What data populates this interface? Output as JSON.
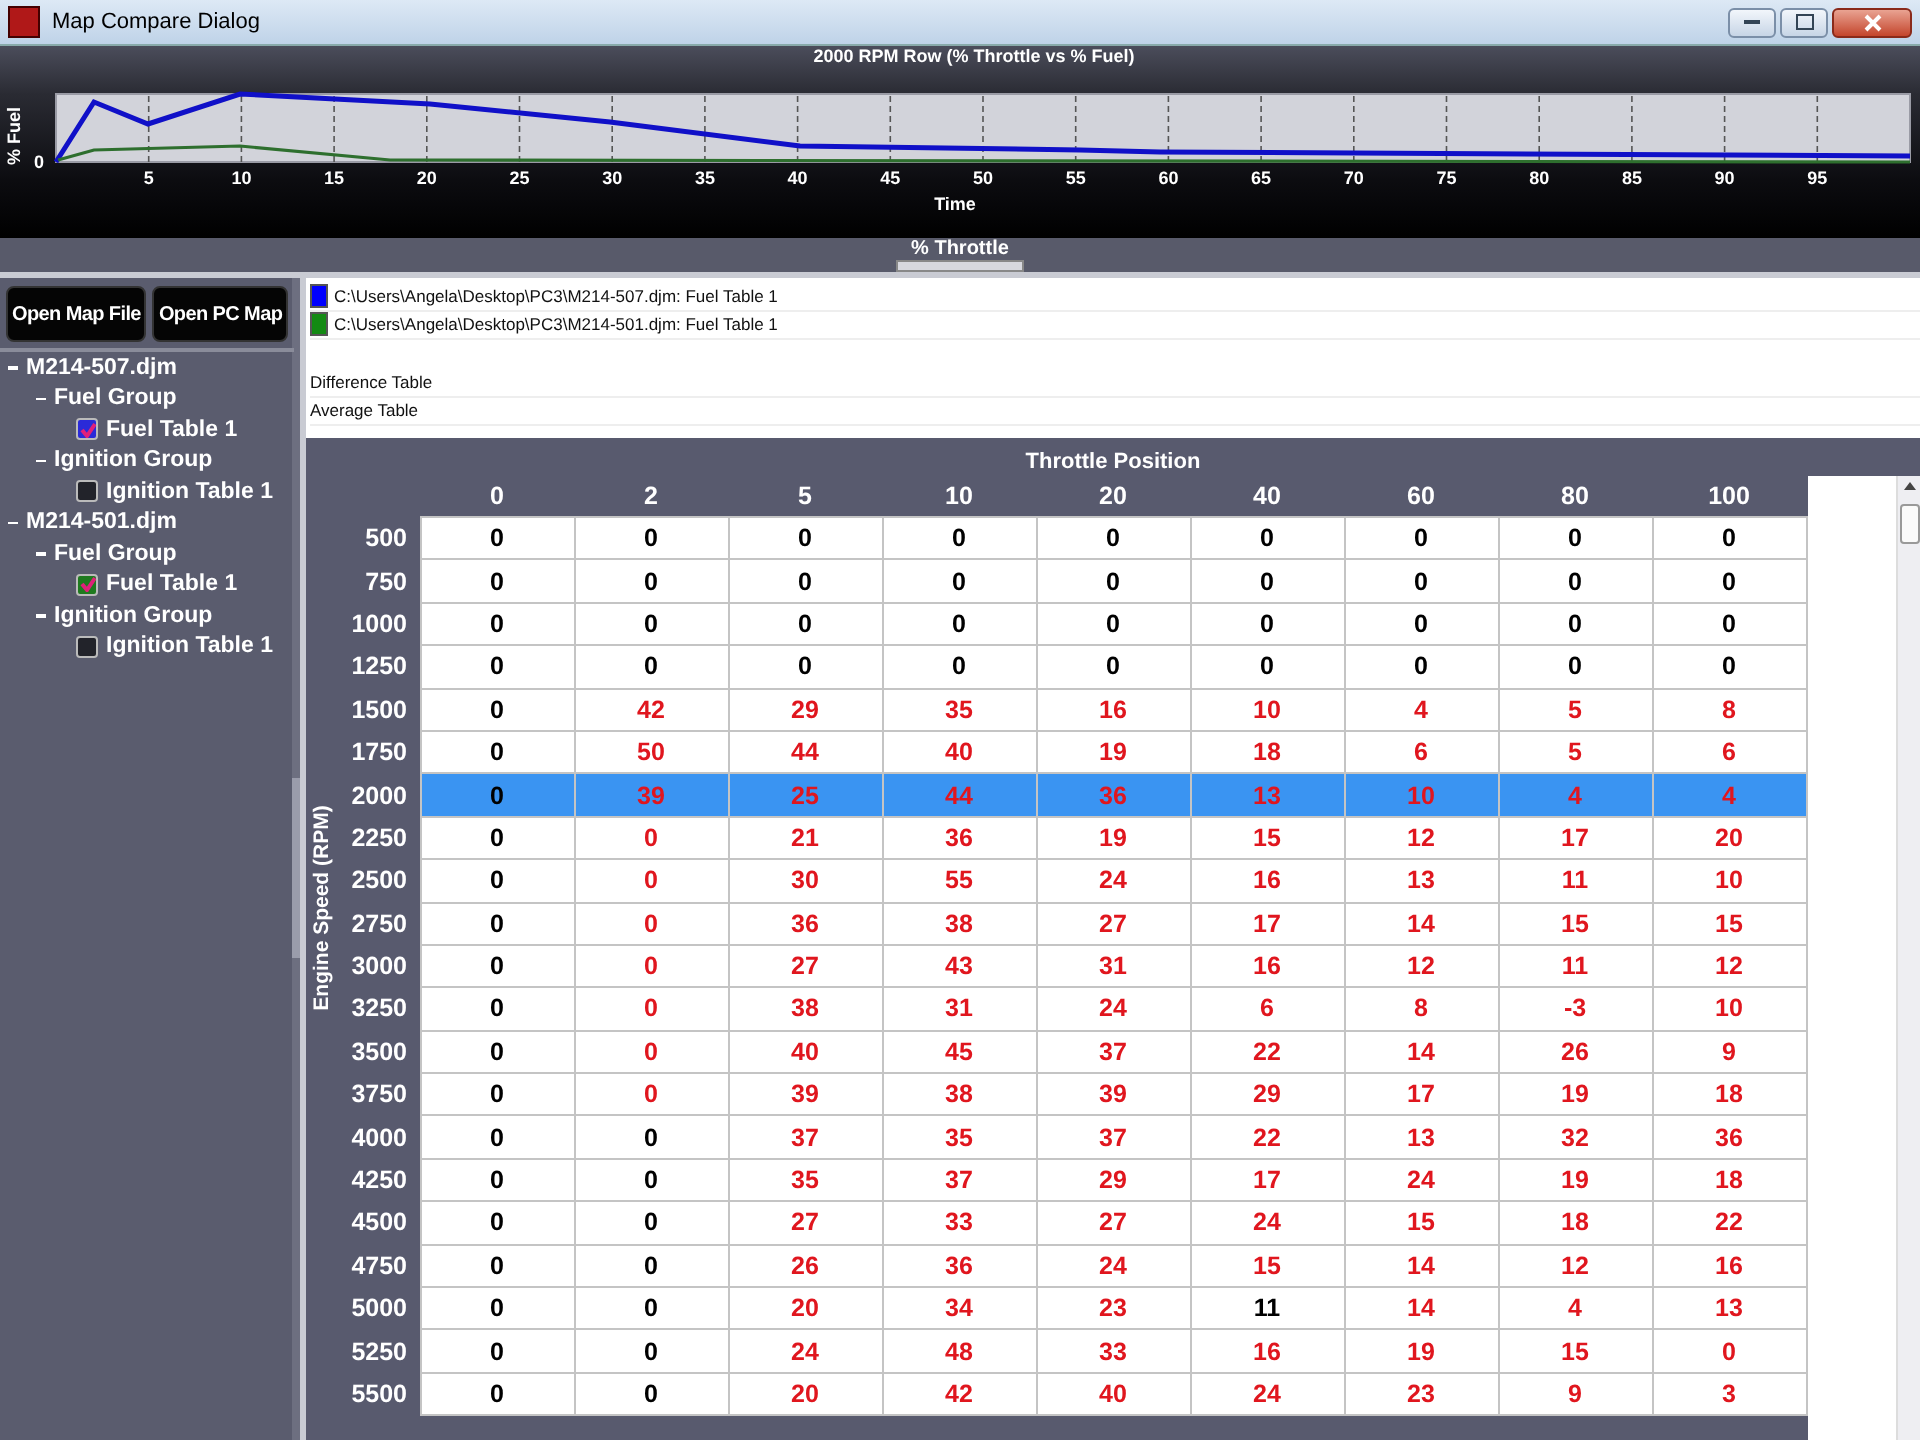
{
  "window": {
    "title": "Map Compare Dialog"
  },
  "chart": {
    "title": "2000 RPM Row (% Throttle vs % Fuel)",
    "ylabel": "% Fuel",
    "y_tick": "0",
    "xlabel": "Time",
    "x_ticks": [
      "5",
      "10",
      "15",
      "20",
      "25",
      "30",
      "35",
      "40",
      "45",
      "50",
      "55",
      "60",
      "65",
      "70",
      "75",
      "80",
      "85",
      "90",
      "95"
    ]
  },
  "splitter": {
    "label": "% Throttle"
  },
  "buttons": [
    "Open Map File",
    "Open PC Map"
  ],
  "tree": [
    {
      "label": "M214-507.djm",
      "expanded": true,
      "children": [
        {
          "label": "Fuel Group",
          "expanded": true,
          "children": [
            {
              "label": "Fuel Table 1",
              "checked": true,
              "color": "#2a2ad8"
            }
          ]
        },
        {
          "label": "Ignition Group",
          "expanded": true,
          "children": [
            {
              "label": "Ignition Table 1",
              "checked": false
            }
          ]
        }
      ]
    },
    {
      "label": "M214-501.djm",
      "expanded": true,
      "children": [
        {
          "label": "Fuel Group",
          "expanded": true,
          "children": [
            {
              "label": "Fuel Table 1",
              "checked": true,
              "color": "#1f7a1f"
            }
          ]
        },
        {
          "label": "Ignition Group",
          "expanded": true,
          "children": [
            {
              "label": "Ignition Table 1",
              "checked": false
            }
          ]
        }
      ]
    }
  ],
  "legend": [
    {
      "text": "C:\\Users\\Angela\\Desktop\\PC3\\M214-507.djm: Fuel Table 1",
      "color": "#0000ff"
    },
    {
      "text": "C:\\Users\\Angela\\Desktop\\PC3\\M214-501.djm: Fuel Table 1",
      "color": "#138a13"
    }
  ],
  "options": [
    "Difference Table",
    "Average Table"
  ],
  "table": {
    "title": "Throttle Position",
    "row_axis": "Engine Speed (RPM)",
    "columns": [
      "0",
      "2",
      "5",
      "10",
      "20",
      "40",
      "60",
      "80",
      "100"
    ],
    "rows": [
      {
        "label": "500",
        "selected": false,
        "values": [
          "0",
          "0",
          "0",
          "0",
          "0",
          "0",
          "0",
          "0",
          "0"
        ],
        "differs": [
          false,
          false,
          false,
          false,
          false,
          false,
          false,
          false,
          false
        ]
      },
      {
        "label": "750",
        "selected": false,
        "values": [
          "0",
          "0",
          "0",
          "0",
          "0",
          "0",
          "0",
          "0",
          "0"
        ],
        "differs": [
          false,
          false,
          false,
          false,
          false,
          false,
          false,
          false,
          false
        ]
      },
      {
        "label": "1000",
        "selected": false,
        "values": [
          "0",
          "0",
          "0",
          "0",
          "0",
          "0",
          "0",
          "0",
          "0"
        ],
        "differs": [
          false,
          false,
          false,
          false,
          false,
          false,
          false,
          false,
          false
        ]
      },
      {
        "label": "1250",
        "selected": false,
        "values": [
          "0",
          "0",
          "0",
          "0",
          "0",
          "0",
          "0",
          "0",
          "0"
        ],
        "differs": [
          false,
          false,
          false,
          false,
          false,
          false,
          false,
          false,
          false
        ]
      },
      {
        "label": "1500",
        "selected": false,
        "values": [
          "0",
          "42",
          "29",
          "35",
          "16",
          "10",
          "4",
          "5",
          "8"
        ],
        "differs": [
          false,
          true,
          true,
          true,
          true,
          true,
          true,
          true,
          true
        ]
      },
      {
        "label": "1750",
        "selected": false,
        "values": [
          "0",
          "50",
          "44",
          "40",
          "19",
          "18",
          "6",
          "5",
          "6"
        ],
        "differs": [
          false,
          true,
          true,
          true,
          true,
          true,
          true,
          true,
          true
        ]
      },
      {
        "label": "2000",
        "selected": true,
        "values": [
          "0",
          "39",
          "25",
          "44",
          "36",
          "13",
          "10",
          "4",
          "4"
        ],
        "differs": [
          false,
          true,
          true,
          true,
          true,
          true,
          true,
          true,
          true
        ]
      },
      {
        "label": "2250",
        "selected": false,
        "values": [
          "0",
          "0",
          "21",
          "36",
          "19",
          "15",
          "12",
          "17",
          "20"
        ],
        "differs": [
          false,
          true,
          true,
          true,
          true,
          true,
          true,
          true,
          true
        ]
      },
      {
        "label": "2500",
        "selected": false,
        "values": [
          "0",
          "0",
          "30",
          "55",
          "24",
          "16",
          "13",
          "11",
          "10"
        ],
        "differs": [
          false,
          true,
          true,
          true,
          true,
          true,
          true,
          true,
          true
        ]
      },
      {
        "label": "2750",
        "selected": false,
        "values": [
          "0",
          "0",
          "36",
          "38",
          "27",
          "17",
          "14",
          "15",
          "15"
        ],
        "differs": [
          false,
          true,
          true,
          true,
          true,
          true,
          true,
          true,
          true
        ]
      },
      {
        "label": "3000",
        "selected": false,
        "values": [
          "0",
          "0",
          "27",
          "43",
          "31",
          "16",
          "12",
          "11",
          "12"
        ],
        "differs": [
          false,
          true,
          true,
          true,
          true,
          true,
          true,
          true,
          true
        ]
      },
      {
        "label": "3250",
        "selected": false,
        "values": [
          "0",
          "0",
          "38",
          "31",
          "24",
          "6",
          "8",
          "-3",
          "10"
        ],
        "differs": [
          false,
          true,
          true,
          true,
          true,
          true,
          true,
          true,
          true
        ]
      },
      {
        "label": "3500",
        "selected": false,
        "values": [
          "0",
          "0",
          "40",
          "45",
          "37",
          "22",
          "14",
          "26",
          "9"
        ],
        "differs": [
          false,
          true,
          true,
          true,
          true,
          true,
          true,
          true,
          true
        ]
      },
      {
        "label": "3750",
        "selected": false,
        "values": [
          "0",
          "0",
          "39",
          "38",
          "39",
          "29",
          "17",
          "19",
          "18"
        ],
        "differs": [
          false,
          true,
          true,
          true,
          true,
          true,
          true,
          true,
          true
        ]
      },
      {
        "label": "4000",
        "selected": false,
        "values": [
          "0",
          "0",
          "37",
          "35",
          "37",
          "22",
          "13",
          "32",
          "36"
        ],
        "differs": [
          false,
          false,
          true,
          true,
          true,
          true,
          true,
          true,
          true
        ]
      },
      {
        "label": "4250",
        "selected": false,
        "values": [
          "0",
          "0",
          "35",
          "37",
          "29",
          "17",
          "24",
          "19",
          "18"
        ],
        "differs": [
          false,
          false,
          true,
          true,
          true,
          true,
          true,
          true,
          true
        ]
      },
      {
        "label": "4500",
        "selected": false,
        "values": [
          "0",
          "0",
          "27",
          "33",
          "27",
          "24",
          "15",
          "18",
          "22"
        ],
        "differs": [
          false,
          false,
          true,
          true,
          true,
          true,
          true,
          true,
          true
        ]
      },
      {
        "label": "4750",
        "selected": false,
        "values": [
          "0",
          "0",
          "26",
          "36",
          "24",
          "15",
          "14",
          "12",
          "16"
        ],
        "differs": [
          false,
          false,
          true,
          true,
          true,
          true,
          true,
          true,
          true
        ]
      },
      {
        "label": "5000",
        "selected": false,
        "values": [
          "0",
          "0",
          "20",
          "34",
          "23",
          "11",
          "14",
          "4",
          "13"
        ],
        "differs": [
          false,
          false,
          true,
          true,
          true,
          false,
          true,
          true,
          true
        ]
      },
      {
        "label": "5250",
        "selected": false,
        "values": [
          "0",
          "0",
          "24",
          "48",
          "33",
          "16",
          "19",
          "15",
          "0"
        ],
        "differs": [
          false,
          false,
          true,
          true,
          true,
          true,
          true,
          true,
          true
        ]
      },
      {
        "label": "5500",
        "selected": false,
        "values": [
          "0",
          "0",
          "20",
          "42",
          "40",
          "24",
          "23",
          "9",
          "3"
        ],
        "differs": [
          false,
          false,
          true,
          true,
          true,
          true,
          true,
          true,
          true
        ]
      }
    ]
  }
}
